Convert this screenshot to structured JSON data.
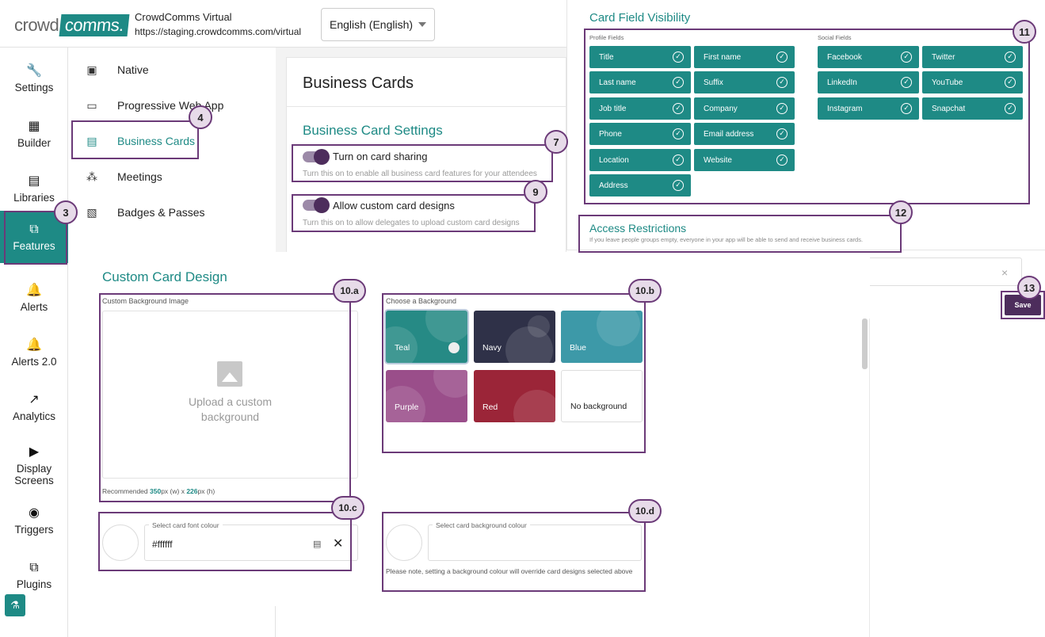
{
  "header": {
    "logo_left": "crowd",
    "logo_right": "comms.",
    "app_name": "CrowdComms Virtual",
    "app_url": "https://staging.crowdcomms.com/virtual",
    "language": "English (English)"
  },
  "nav": [
    {
      "label": "Settings",
      "icon": "wrench-icon",
      "glyph": "🔧"
    },
    {
      "label": "Builder",
      "icon": "grid-icon",
      "glyph": "▦"
    },
    {
      "label": "Libraries",
      "icon": "library-icon",
      "glyph": "▤"
    },
    {
      "label": "Features",
      "icon": "features-icon",
      "glyph": "⧉"
    },
    {
      "label": "Alerts",
      "icon": "bell-icon",
      "glyph": "🔔"
    },
    {
      "label": "Alerts 2.0",
      "icon": "bell-icon",
      "glyph": "🔔"
    },
    {
      "label": "Analytics",
      "icon": "trend-icon",
      "glyph": "↗"
    },
    {
      "label": "Display\nScreens",
      "icon": "play-screen-icon",
      "glyph": "▶"
    },
    {
      "label": "Triggers",
      "icon": "eye-icon",
      "glyph": "◉"
    },
    {
      "label": "Plugins",
      "icon": "plugin-icon",
      "glyph": "⧉"
    }
  ],
  "subnav": [
    {
      "label": "Native",
      "glyph": "▣"
    },
    {
      "label": "Progressive Web App",
      "glyph": "▭"
    },
    {
      "label": "Business Cards",
      "glyph": "▤"
    },
    {
      "label": "Meetings",
      "glyph": "⁂"
    },
    {
      "label": "Badges & Passes",
      "glyph": "▧"
    }
  ],
  "business_cards": {
    "title": "Business Cards",
    "settings_title": "Business Card Settings",
    "toggle1_label": "Turn on card sharing",
    "toggle1_help": "Turn this on to enable all business card features for your attendees",
    "toggle2_label": "Allow custom card designs",
    "toggle2_help": "Turn this on to allow delegates to upload custom card designs"
  },
  "card_field_visibility": {
    "title": "Card Field Visibility",
    "profile_label": "Profile Fields",
    "social_label": "Social Fields",
    "profile_fields": [
      "Title",
      "First name",
      "Last name",
      "Suffix",
      "Job title",
      "Company",
      "Phone",
      "Email address",
      "Location",
      "Website",
      "Address"
    ],
    "social_fields": [
      "Facebook",
      "Twitter",
      "LinkedIn",
      "YouTube",
      "Instagram",
      "Snapchat"
    ],
    "check_glyph": "✓"
  },
  "access_restrictions": {
    "title": "Access Restrictions",
    "help": "If you leave people groups empty, everyone in your app will be able to send and receive business cards.",
    "clear_glyph": "×"
  },
  "save_label": "Save",
  "custom_card_design": {
    "title": "Custom Card Design",
    "bg_image_label": "Custom Background Image",
    "upload_text": "Upload a custom background",
    "rec_prefix": "Recommended ",
    "rec_w": "350",
    "rec_mid": "px (w) x ",
    "rec_h": "226",
    "rec_suffix": "px (h)",
    "choose_bg_label": "Choose a Background",
    "backgrounds": [
      {
        "label": "Teal",
        "color": "#268a85"
      },
      {
        "label": "Navy",
        "color": "#2f3148"
      },
      {
        "label": "Blue",
        "color": "#3d99a8"
      },
      {
        "label": "Purple",
        "color": "#9a4e8a"
      },
      {
        "label": "Red",
        "color": "#9b2538"
      },
      {
        "label": "No background",
        "color": "#ffffff"
      }
    ],
    "font_colour_label": "Select card font colour",
    "font_colour_value": "#ffffff",
    "bg_colour_label": "Select card background colour",
    "bg_colour_note": "Please note, setting a background colour will override card designs selected above"
  },
  "badges": {
    "b3": "3",
    "b4": "4",
    "b7": "7",
    "b9": "9",
    "b10a": "10.a",
    "b10b": "10.b",
    "b10c": "10.c",
    "b10d": "10.d",
    "b11": "11",
    "b12": "12",
    "b13": "13"
  },
  "colors": {
    "accent": "#1e8a85",
    "highlight": "#6b3a78",
    "save": "#4d2d5c"
  }
}
